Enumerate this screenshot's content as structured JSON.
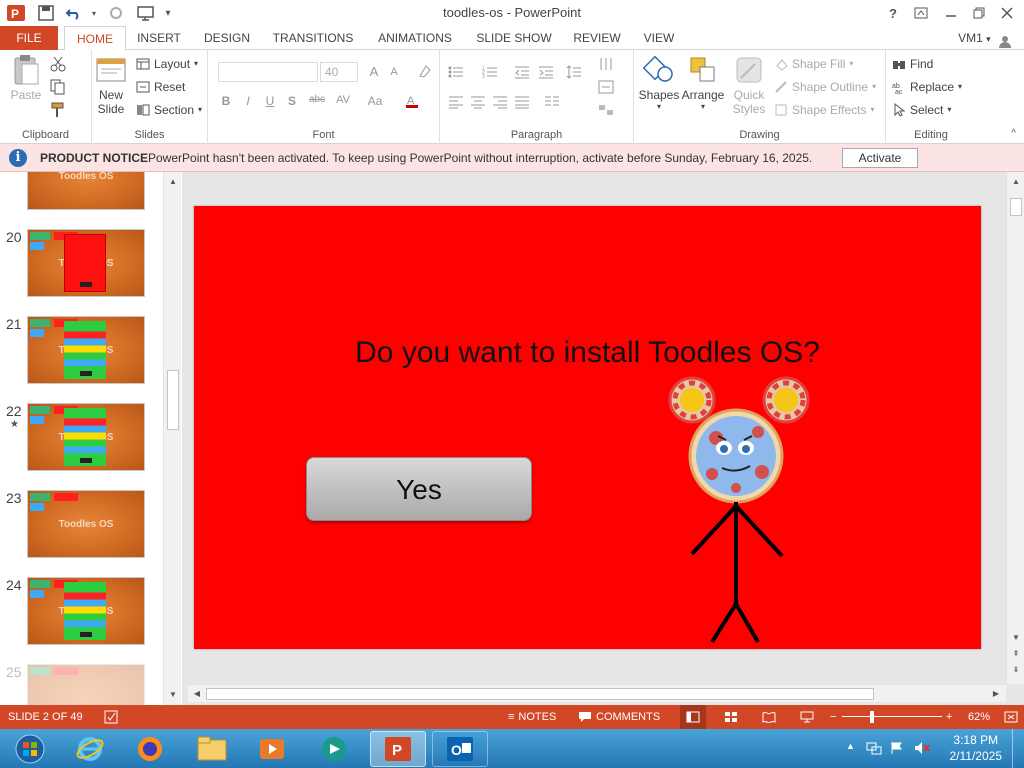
{
  "window": {
    "title": "toodles-os - PowerPoint",
    "help": "?",
    "account": "VM1"
  },
  "tabs": [
    {
      "label": "FILE"
    },
    {
      "label": "HOME"
    },
    {
      "label": "INSERT"
    },
    {
      "label": "DESIGN"
    },
    {
      "label": "TRANSITIONS"
    },
    {
      "label": "ANIMATIONS"
    },
    {
      "label": "SLIDE SHOW"
    },
    {
      "label": "REVIEW"
    },
    {
      "label": "VIEW"
    }
  ],
  "ribbon": {
    "clipboard": {
      "label": "Clipboard",
      "paste": "Paste"
    },
    "slides": {
      "label": "Slides",
      "new_slide_1": "New",
      "new_slide_2": "Slide",
      "layout": "Layout",
      "reset": "Reset",
      "section": "Section"
    },
    "font": {
      "label": "Font",
      "size": "40",
      "bold": "B",
      "italic": "I",
      "underline": "U",
      "shadow": "S",
      "strike": "abc",
      "spacing": "AV",
      "case": "Aa",
      "grow": "A",
      "shrink": "A"
    },
    "paragraph": {
      "label": "Paragraph"
    },
    "drawing": {
      "label": "Drawing",
      "shapes": "Shapes",
      "arrange": "Arrange",
      "quick_styles_1": "Quick",
      "quick_styles_2": "Styles",
      "shape_fill": "Shape Fill",
      "shape_outline": "Shape Outline",
      "shape_effects": "Shape Effects"
    },
    "editing": {
      "label": "Editing",
      "find": "Find",
      "replace": "Replace",
      "select": "Select"
    }
  },
  "notice": {
    "title": "PRODUCT NOTICE",
    "text": "PowerPoint hasn't been activated. To keep using PowerPoint without interruption, activate before Sunday, February 16, 2025.",
    "button": "Activate"
  },
  "thumbnails": [
    {
      "number": "",
      "title": "Toodles OS"
    },
    {
      "number": "20",
      "title": "Toodles OS"
    },
    {
      "number": "21",
      "title": "Toodles OS"
    },
    {
      "number": "22",
      "title": "Toodles OS"
    },
    {
      "number": "23",
      "title": "Toodles OS"
    },
    {
      "number": "24",
      "title": "Toodles OS"
    },
    {
      "number": "25",
      "title": ""
    }
  ],
  "slide": {
    "question": "Do you want to install Toodles OS?",
    "yes": "Yes"
  },
  "status": {
    "slide": "SLIDE 2 OF 49",
    "notes": "NOTES",
    "comments": "COMMENTS",
    "zoom": "62%"
  },
  "taskbar": {
    "time": "3:18 PM",
    "date": "2/11/2025"
  }
}
